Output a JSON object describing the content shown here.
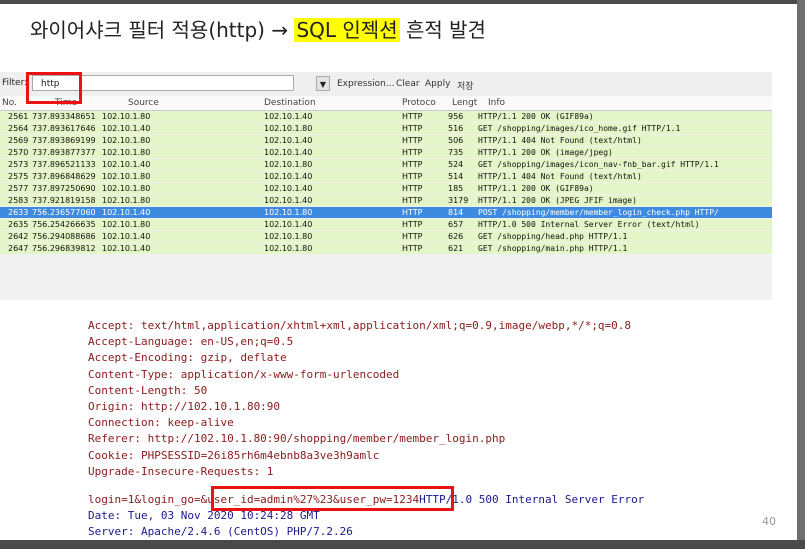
{
  "slide": {
    "title_prefix": "와이어샤크 필터 적용(http) → ",
    "title_highlight": "SQL 인젝션",
    "title_suffix": " 흔적 발견",
    "highlight_color": "#ffff00",
    "page_number": "40"
  },
  "wireshark": {
    "filter_label": "Filter:",
    "filter_value": "http",
    "expression_label": "Expression...",
    "clear_label": "Clear",
    "apply_label": "Apply",
    "save_label": "저장",
    "columns": [
      "No.",
      "Time",
      "Source",
      "Destination",
      "Protoco",
      "Lengt",
      "Info"
    ],
    "rows": [
      {
        "no": "2561",
        "time": "737.893348651",
        "src": "102.10.1.80",
        "dst": "102.10.1.40",
        "proto": "HTTP",
        "len": "956",
        "info": "HTTP/1.1 200 OK  (GIF89a)"
      },
      {
        "no": "2564",
        "time": "737.893617646",
        "src": "102.10.1.40",
        "dst": "102.10.1.80",
        "proto": "HTTP",
        "len": "516",
        "info": "GET /shopping/images/ico_home.gif HTTP/1.1"
      },
      {
        "no": "2569",
        "time": "737.893869199",
        "src": "102.10.1.80",
        "dst": "102.10.1.40",
        "proto": "HTTP",
        "len": "506",
        "info": "HTTP/1.1 404 Not Found  (text/html)"
      },
      {
        "no": "2570",
        "time": "737.893877377",
        "src": "102.10.1.80",
        "dst": "102.10.1.40",
        "proto": "HTTP",
        "len": "735",
        "info": "HTTP/1.1 200 OK  (image/jpeg)"
      },
      {
        "no": "2573",
        "time": "737.896521133",
        "src": "102.10.1.40",
        "dst": "102.10.1.80",
        "proto": "HTTP",
        "len": "524",
        "info": "GET /shopping/images/icon_nav-fnb_bar.gif HTTP/1.1"
      },
      {
        "no": "2575",
        "time": "737.896848629",
        "src": "102.10.1.80",
        "dst": "102.10.1.40",
        "proto": "HTTP",
        "len": "514",
        "info": "HTTP/1.1 404 Not Found  (text/html)"
      },
      {
        "no": "2577",
        "time": "737.897250690",
        "src": "102.10.1.80",
        "dst": "102.10.1.40",
        "proto": "HTTP",
        "len": "185",
        "info": "HTTP/1.1 200 OK  (GIF89a)"
      },
      {
        "no": "2583",
        "time": "737.921819158",
        "src": "102.10.1.80",
        "dst": "102.10.1.40",
        "proto": "HTTP",
        "len": "3179",
        "info": "HTTP/1.1 200 OK  (JPEG JFIF image)"
      },
      {
        "no": "2633",
        "time": "756.236577060",
        "src": "102.10.1.40",
        "dst": "102.10.1.80",
        "proto": "HTTP",
        "len": "814",
        "info": "POST /shopping/member/member_login_check.php HTTP/"
      },
      {
        "no": "2635",
        "time": "756.254266635",
        "src": "102.10.1.80",
        "dst": "102.10.1.40",
        "proto": "HTTP",
        "len": "657",
        "info": "HTTP/1.0 500 Internal Server Error  (text/html)"
      },
      {
        "no": "2642",
        "time": "756.294088686",
        "src": "102.10.1.40",
        "dst": "102.10.1.80",
        "proto": "HTTP",
        "len": "626",
        "info": "GET /shopping/head.php HTTP/1.1"
      },
      {
        "no": "2647",
        "time": "756.296839812",
        "src": "102.10.1.40",
        "dst": "102.10.1.80",
        "proto": "HTTP",
        "len": "621",
        "info": "GET /shopping/main.php HTTP/1.1"
      }
    ],
    "selected_row_color": "#3d8be0",
    "row_color": "#e4f6c7"
  },
  "stream": {
    "request_lines": [
      "Accept: text/html,application/xhtml+xml,application/xml;q=0.9,image/webp,*/*;q=0.8",
      "Accept-Language: en-US,en;q=0.5",
      "Accept-Encoding: gzip, deflate",
      "Content-Type: application/x-www-form-urlencoded",
      "Content-Length: 50",
      "Origin: http://102.10.1.80:90",
      "Connection: keep-alive",
      "Referer: http://102.10.1.80:90/shopping/member/member_login.php",
      "Cookie: PHPSESSID=26i85rh6m4ebnb8a3ve3h9amlc",
      "Upgrade-Insecure-Requests: 1"
    ],
    "body_line": "login=1&login_go=&user_id=admin%27%23&user_pw=1234",
    "response_first": "HTTP/1.0 500 Internal Server Error",
    "response_lines": [
      "Date: Tue, 03 Nov 2020 10:24:28 GMT",
      "Server: Apache/2.4.6 (CentOS) PHP/7.2.26"
    ],
    "client_color": "#8a1a1a",
    "server_color": "#1a1a8a"
  }
}
